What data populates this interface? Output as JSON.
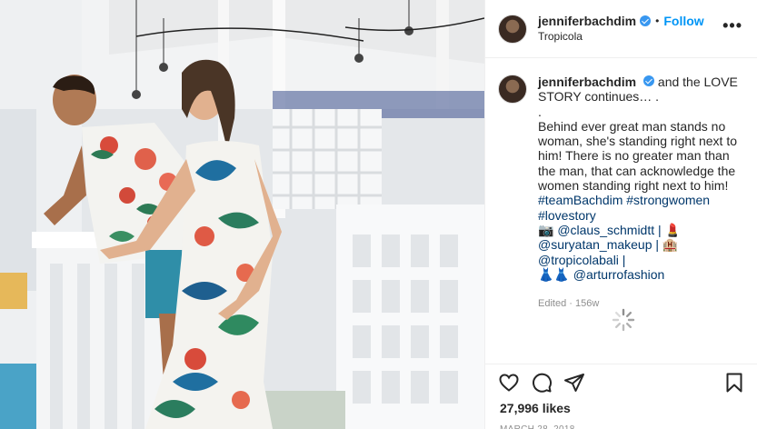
{
  "post": {
    "username": "jenniferbachdim",
    "follow_label": "Follow",
    "location": "Tropicola",
    "more_label": "•••"
  },
  "caption": {
    "username": "jenniferbachdim",
    "lines": [
      "and the LOVE STORY continues… .",
      ".",
      "Behind ever great man stands no woman, she's standing right next to him! There is no greater man than the man, that can acknowledge the women standing right next to him!"
    ],
    "hashtags_line1": "#teamBachdim #strongwomen",
    "hashtags_line2": "#lovestory",
    "credits_1": "📷 @claus_schmidtt | 💄",
    "credits_2": "@suryatan_makeup | 🏨 @tropicolabali |",
    "credits_3": "👗👗 @arturrofashion",
    "edited": "Edited · 156w"
  },
  "actions": {
    "likes": "27,996 likes",
    "date": "MARCH 28, 2018",
    "icons": [
      "heart-icon",
      "comment-icon",
      "share-icon",
      "bookmark-icon"
    ]
  },
  "colors": {
    "accent": "#0095f6",
    "verified": "#3897f0",
    "hashtag": "#00376b",
    "muted": "#8e8e8e"
  }
}
